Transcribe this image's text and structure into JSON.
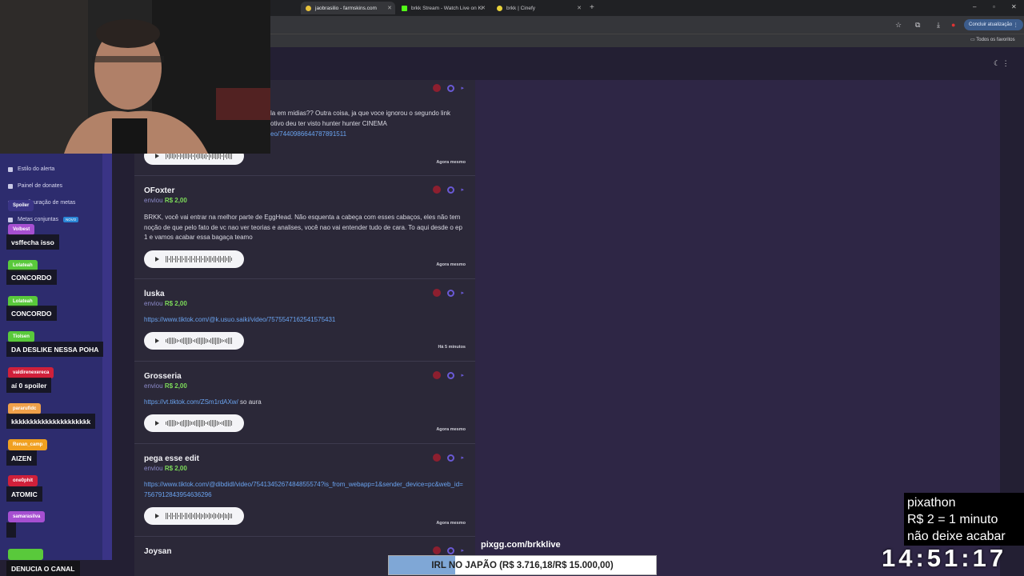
{
  "browser": {
    "tabs": [
      {
        "title": "jaobrasilio - farmskins.com",
        "active": true
      },
      {
        "title": "brkk Stream - Watch Live on Ki"
      },
      {
        "title": "brkk | Cinefy"
      }
    ],
    "update_button": "Concluir atualização",
    "bookmarks_label": "Todos os favoritos"
  },
  "sidebar": {
    "items": [
      {
        "label": "Estilo do alerta"
      },
      {
        "label": "Painel de donates"
      },
      {
        "label": "Configuração de metas"
      },
      {
        "label": "Metas conjuntas",
        "badge": "NOVO"
      }
    ]
  },
  "donations": [
    {
      "message": "la em midias?? Outra coisa, ja que voce ignorou o segundo link",
      "message2": "otivo deu ter visto hunter hunter CINEMA",
      "link": "eo/7440986644787891511",
      "time": "Agora mesmo"
    },
    {
      "name": "OFoxter",
      "sent": "enviou",
      "amount": "R$ 2,00",
      "message": "BRKK, você vai entrar na melhor parte de EggHead. Não esquenta a cabeça com esses cabaços, eles não tem noção de que pelo fato de vc nao ver teorias e analises, você nao vai entender tudo de cara. To aqui desde o ep 1 e vamos acabar essa bagaça teamo",
      "time": "Agora mesmo"
    },
    {
      "name": "luska",
      "sent": "enviou",
      "amount": "R$ 2,00",
      "link": "https://www.tiktok.com/@k.usuo.saiki/video/7575547162541575431",
      "time": "Há 5 minutos"
    },
    {
      "name": "Grosseria",
      "sent": "enviou",
      "amount": "R$ 2,00",
      "link": "https://vt.tiktok.com/ZSm1rdAXw/",
      "message": "so aura",
      "time": "Agora mesmo"
    },
    {
      "name": "pega esse edit",
      "sent": "enviou",
      "amount": "R$ 2,00",
      "link": "https://www.tiktok.com/@dibdidl/video/7541345267484855574?is_from_webapp=1&sender_device=pc&web_id=7567912843954636296",
      "time": "Agora mesmo"
    },
    {
      "name": "Joysan"
    }
  ],
  "chat": [
    {
      "user": "Spoiler",
      "message": "",
      "color": "#3a3486"
    },
    {
      "user": "Volbest",
      "message": "vsffecha isso",
      "color": "#a64fd1"
    },
    {
      "user": "Lolateah",
      "message": "CONCORDO",
      "color": "#59c93b"
    },
    {
      "user": "Lolateah",
      "message": "CONCORDO",
      "color": "#59c93b"
    },
    {
      "user": "Tiolsen",
      "message": "DA DESLIKE NESSA POHA",
      "color": "#59c93b"
    },
    {
      "user": "valdirenexereca",
      "message": "aí 0 spoiler",
      "color": "#d0203a"
    },
    {
      "user": "pararufidc",
      "message": "kkkkkkkkkkkkkkkkkkkkk",
      "color": "#f0a14a"
    },
    {
      "user": "Renan_camp",
      "message": "AIZEN",
      "color": "#f0a020"
    },
    {
      "user": "one0phit",
      "message": "ATOMIC",
      "color": "#d0203a"
    },
    {
      "user": "samarasilva",
      "message": "",
      "color": "#a64fd1"
    },
    {
      "user": "",
      "message": "DENUCIA O CANAL",
      "color": "#59c93b"
    }
  ],
  "overlay": {
    "pix_url": "pixgg.com/brkklive",
    "goal_text": "IRL NO JAPÃO (R$ 3.716,18/R$ 15.000,00)",
    "goal_progress": 0.2477,
    "pixathon": [
      "pixathon",
      "R$ 2 = 1 minuto",
      "não deixe acabar"
    ],
    "clock": "14:51:17"
  }
}
